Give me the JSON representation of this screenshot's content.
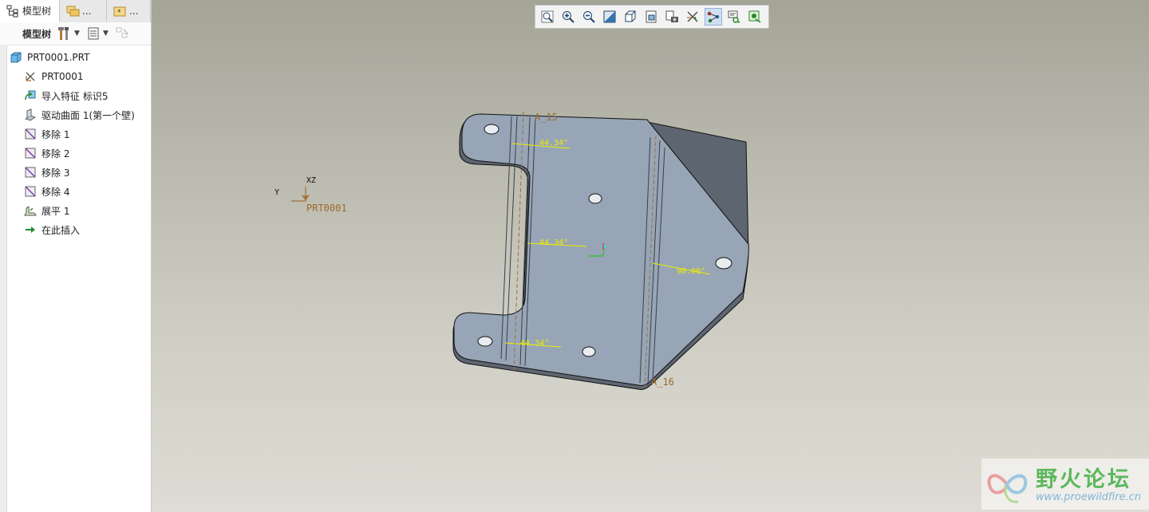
{
  "left_panel": {
    "tabs": [
      {
        "label": "模型树"
      },
      {
        "label": "..."
      },
      {
        "label": "..."
      }
    ],
    "toolbar_title": "模型树",
    "tree": {
      "root": "PRT0001.PRT",
      "items": [
        {
          "label": "PRT0001",
          "icon": "csys-icon"
        },
        {
          "label": "导入特征 标识5",
          "icon": "import-feature-icon"
        },
        {
          "label": "驱动曲面 1(第一个壁)",
          "icon": "driving-surface-icon"
        },
        {
          "label": "移除 1",
          "icon": "remove-icon"
        },
        {
          "label": "移除 2",
          "icon": "remove-icon"
        },
        {
          "label": "移除 3",
          "icon": "remove-icon"
        },
        {
          "label": "移除 4",
          "icon": "remove-icon"
        },
        {
          "label": "展平 1",
          "icon": "flatten-icon"
        },
        {
          "label": "在此插入",
          "icon": "insert-here-arrow-icon"
        }
      ]
    }
  },
  "graphics": {
    "view_toolbar": [
      "refit-icon",
      "zoom-in-icon",
      "zoom-out-icon",
      "repaint-icon",
      "display-style-icon",
      "saved-views-icon",
      "view-manager-icon",
      "datum-display-icon",
      "spin-center-icon",
      "annotation-display-icon",
      "appearance-icon"
    ],
    "csys": {
      "label": "PRT0001",
      "axis_y": "Y",
      "axis_xz": "XZ"
    },
    "annotations": {
      "a15": "A_15",
      "a16": "A_16",
      "dim_top": "44.34°",
      "dim_mid": "44.34°",
      "dim_bottom": "44.34°",
      "dim_right": "90.00°"
    },
    "colors": {
      "part_fill": "#97a5b6",
      "dimension_yellow": "#eeee00",
      "datum_brown": "#a0703a"
    }
  },
  "watermark": {
    "title": "野火论坛",
    "url": "www.proewildfire.cn"
  }
}
